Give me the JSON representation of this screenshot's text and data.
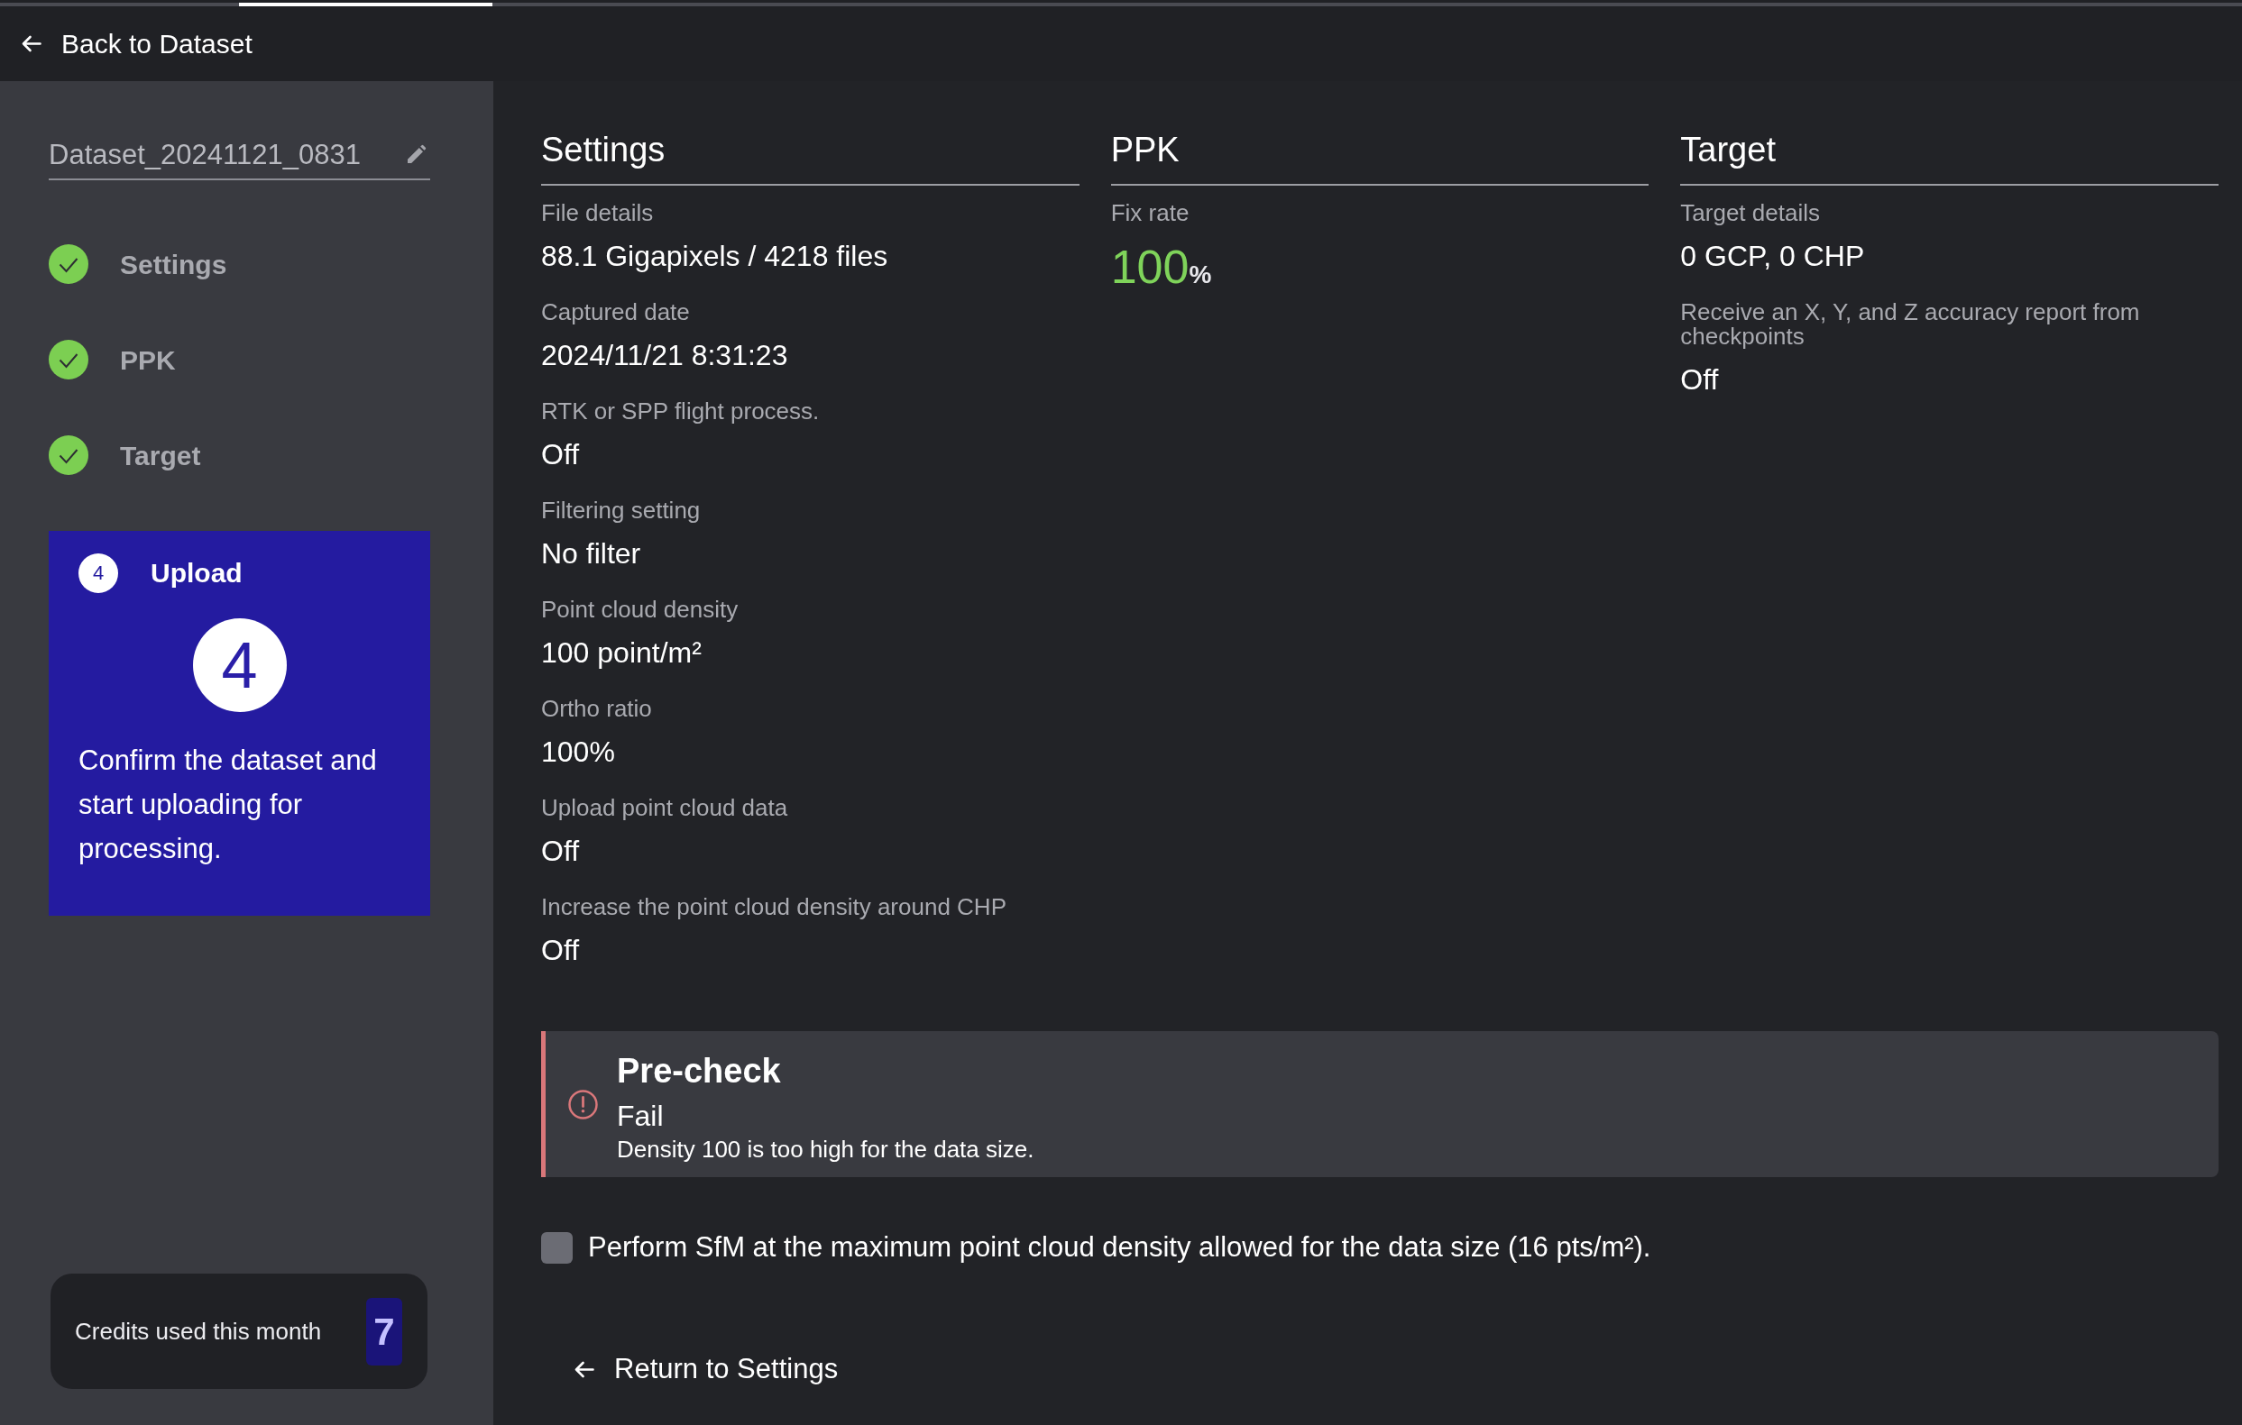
{
  "header": {
    "back_link": "Back to Dataset"
  },
  "sidebar": {
    "dataset_name": "Dataset_20241121_0831",
    "steps": [
      {
        "label": "Settings",
        "done": true,
        "selected": false
      },
      {
        "label": "PPK",
        "done": true,
        "selected": false
      },
      {
        "label": "Target",
        "done": true,
        "selected": false
      },
      {
        "label": "Upload",
        "number": "4",
        "done": false,
        "selected": true,
        "big_number": "4",
        "description": "Confirm the dataset and start uploading for processing."
      }
    ],
    "credits": {
      "label": "Credits used this month",
      "value": "7"
    }
  },
  "sections": [
    {
      "title": "Settings",
      "fields": [
        {
          "kind": "text",
          "label": "File details",
          "value": "88.1 Gigapixels / 4218 files"
        },
        {
          "kind": "text",
          "label": "Captured date",
          "value": "2024/11/21 8:31:23"
        },
        {
          "kind": "text",
          "label": "RTK or SPP flight process.",
          "value": "Off"
        },
        {
          "kind": "text",
          "label": "Filtering setting",
          "value": "No filter"
        },
        {
          "kind": "text",
          "label": "Point cloud density",
          "value": "100 point/m²"
        },
        {
          "kind": "text",
          "label": "Ortho ratio",
          "value": "100%"
        },
        {
          "kind": "text",
          "label": "Upload point cloud data",
          "value": "Off"
        },
        {
          "kind": "text",
          "label": "Increase the point cloud density around CHP",
          "value": "Off"
        }
      ]
    },
    {
      "title": "PPK",
      "fields": [
        {
          "kind": "rate",
          "label": "Fix rate",
          "value": "100",
          "unit": "%"
        }
      ]
    },
    {
      "title": "Target",
      "fields": [
        {
          "kind": "text",
          "label": "Target details",
          "value": "0 GCP, 0 CHP"
        },
        {
          "kind": "text",
          "label": "Receive an X, Y, and Z accuracy report from checkpoints",
          "value": "Off"
        }
      ]
    }
  ],
  "precheck": {
    "kind": "error",
    "title": "Pre-check",
    "status": "Fail",
    "message": "Density 100 is too high for the data size."
  },
  "option": {
    "label": "Perform SfM at the maximum point cloud density allowed for the data size (16 pts/m²).",
    "checked": false
  },
  "return_link": "Return to Settings"
}
